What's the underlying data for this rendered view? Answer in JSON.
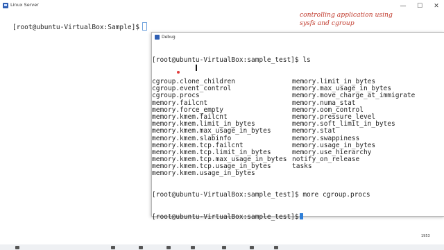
{
  "background_window": {
    "title": "Linux Server",
    "controls": {
      "minimize": "—",
      "maximize": "☐",
      "close": "✕"
    },
    "prompt": "[root@ubuntu-VirtualBox:Sample]$"
  },
  "annotation": {
    "line1": "controlling application using",
    "line2": "sysfs and cgroup"
  },
  "debug_window": {
    "title": "Debug",
    "first_prompt": "[root@ubuntu-VirtualBox:sample_test]$ ls",
    "listing": [
      [
        "cgroup.clone_children",
        "memory.limit_in_bytes"
      ],
      [
        "cgroup.event_control",
        "memory.max_usage_in_bytes"
      ],
      [
        "cgroup.procs",
        "memory.move_charge_at_immigrate"
      ],
      [
        "memory.failcnt",
        "memory.numa_stat"
      ],
      [
        "memory.force_empty",
        "memory.oom_control"
      ],
      [
        "memory.kmem.failcnt",
        "memory.pressure_level"
      ],
      [
        "memory.kmem.limit_in_bytes",
        "memory.soft_limit_in_bytes"
      ],
      [
        "memory.kmem.max_usage_in_bytes",
        "memory.stat"
      ],
      [
        "memory.kmem.slabinfo",
        "memory.swappiness"
      ],
      [
        "memory.kmem.tcp.failcnt",
        "memory.usage_in_bytes"
      ],
      [
        "memory.kmem.tcp.limit_in_bytes",
        "memory.use_hierarchy"
      ],
      [
        "memory.kmem.tcp.max_usage_in_bytes",
        "notify_on_release"
      ],
      [
        "memory.kmem.tcp.usage_in_bytes",
        "tasks"
      ],
      [
        "memory.kmem.usage_in_bytes",
        ""
      ]
    ],
    "command_line": "[root@ubuntu-VirtualBox:sample_test]$ more cgroup.procs",
    "last_prompt": "[root@ubuntu-VirtualBox:sample_test]$"
  },
  "taskbar": {
    "clock": "1953"
  }
}
